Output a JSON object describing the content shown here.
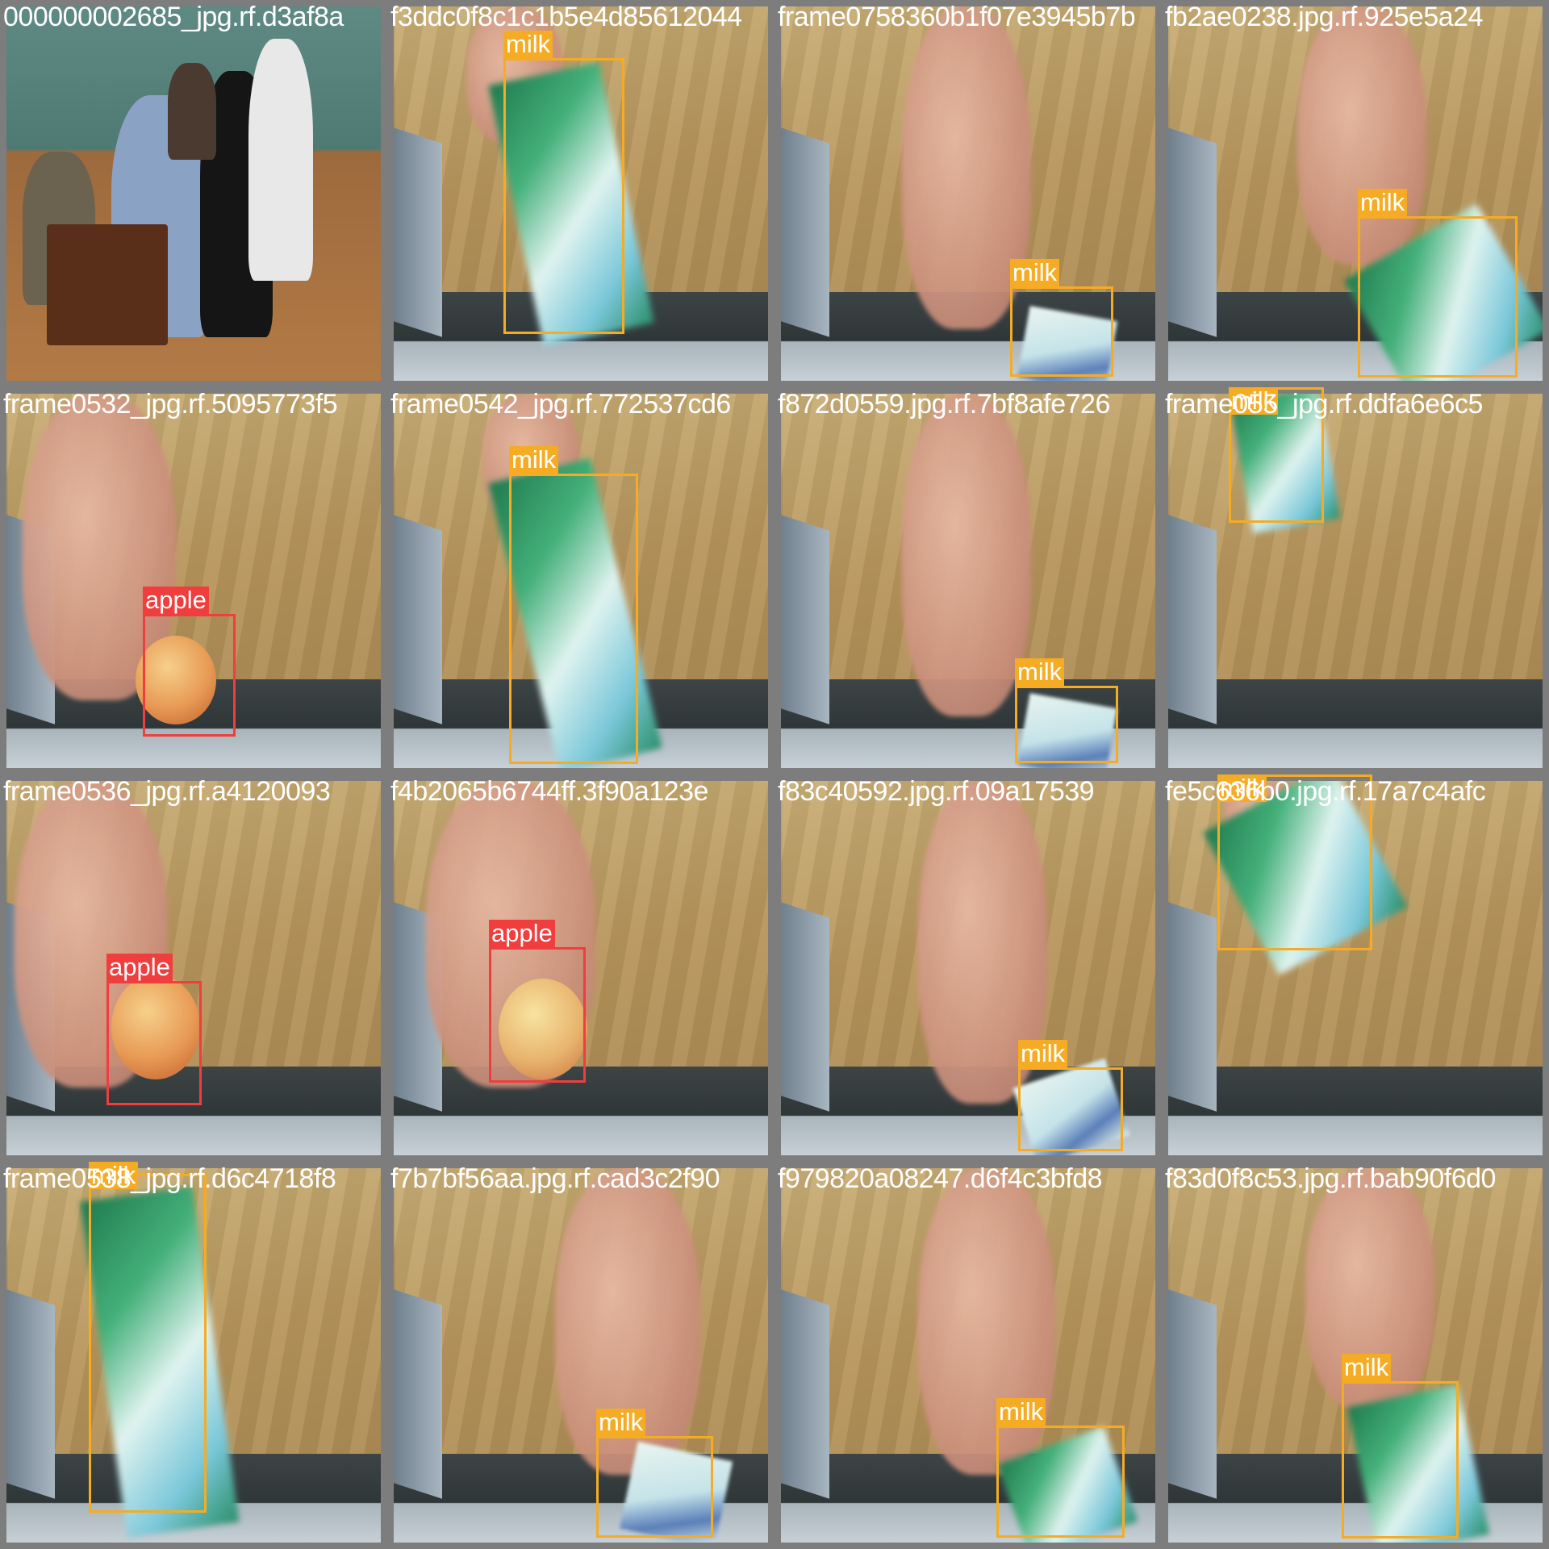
{
  "colors": {
    "milk": "#f5ac24",
    "apple": "#f03d3d",
    "tile_border": "#7d7d7d",
    "caption": "#ffffff"
  },
  "tiles": [
    {
      "caption": "000000002685_jpg.rf.d3af8a",
      "scene": "store",
      "detections": []
    },
    {
      "caption": "f3ddc0f8c1c1b5e4d85612044",
      "scene": "milk-tall",
      "detections": [
        {
          "label": "milk"
        }
      ]
    },
    {
      "caption": "frame0758360b1f07e3945b7b",
      "scene": "milk-bin",
      "detections": [
        {
          "label": "milk"
        }
      ]
    },
    {
      "caption": "fb2ae0238.jpg.rf.925e5a24",
      "scene": "milk-right",
      "detections": [
        {
          "label": "milk"
        }
      ]
    },
    {
      "caption": "frame0532_jpg.rf.5095773f5",
      "scene": "apple-hand",
      "detections": [
        {
          "label": "apple"
        }
      ]
    },
    {
      "caption": "frame0542_jpg.rf.772537cd6",
      "scene": "milk-tall2",
      "detections": [
        {
          "label": "milk"
        }
      ]
    },
    {
      "caption": "f872d0559.jpg.rf.7bf8afe726",
      "scene": "milk-bin",
      "detections": [
        {
          "label": "milk"
        }
      ]
    },
    {
      "caption": "frame055_jpg.rf.ddfa6e6c5",
      "scene": "milk-top",
      "detections": [
        {
          "label": "milk"
        }
      ]
    },
    {
      "caption": "frame0536_jpg.rf.a4120093",
      "scene": "apple-hand2",
      "detections": [
        {
          "label": "apple"
        }
      ]
    },
    {
      "caption": "f4b2065b6744ff.3f90a123e",
      "scene": "apple-hand3",
      "detections": [
        {
          "label": "apple"
        }
      ]
    },
    {
      "caption": "f83c40592.jpg.rf.09a17539",
      "scene": "milk-bin2",
      "detections": [
        {
          "label": "milk"
        }
      ]
    },
    {
      "caption": "fe5c636b0.jpg.rf.17a7c4afc",
      "scene": "milk-top2",
      "detections": [
        {
          "label": "milk"
        }
      ]
    },
    {
      "caption": "frame0538_jpg.rf.d6c4718f8",
      "scene": "milk-tall3",
      "detections": [
        {
          "label": "milk"
        }
      ]
    },
    {
      "caption": "f7b7bf56aa.jpg.rf.cad3c2f90",
      "scene": "milk-bin3",
      "detections": [
        {
          "label": "milk"
        }
      ]
    },
    {
      "caption": "f979820a08247.d6f4c3bfd8",
      "scene": "milk-bin4",
      "detections": [
        {
          "label": "milk"
        }
      ]
    },
    {
      "caption": "f83d0f8c53.jpg.rf.bab90f6d0",
      "scene": "milk-right2",
      "detections": [
        {
          "label": "milk"
        }
      ]
    }
  ]
}
